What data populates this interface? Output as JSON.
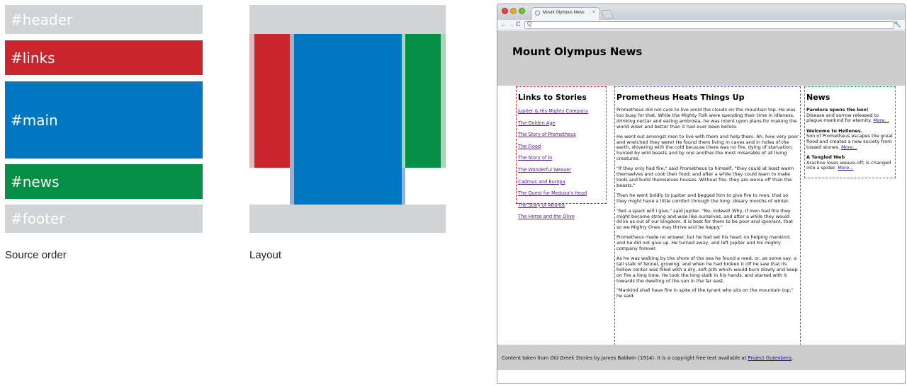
{
  "source_order": {
    "caption": "Source order",
    "blocks": [
      "#header",
      "#links",
      "#main",
      "#news",
      "#footer"
    ]
  },
  "layout": {
    "caption": "Layout"
  },
  "colors": {
    "header": "#d1d3d4",
    "links": "#c9252c",
    "main": "#0077c0",
    "news": "#058e45",
    "footer": "#d1d3d4"
  },
  "browser": {
    "tab_title": "Mount Olympus News",
    "tab_close": "×",
    "nav_back": "←",
    "nav_forward": "→",
    "nav_reload": "C",
    "url_icon": "Q",
    "wrench": "🔧",
    "page": {
      "title": "Mount Olympus News",
      "links_heading": "Links to Stories",
      "links": [
        "Jupiter & His Mighty Company",
        "The Golden Age",
        "The Story of Prometheus",
        "The Flood",
        "The Story of Io",
        "The Wonderful Weaver",
        "Cadmus and Europa",
        "The Quest for Medusa's Head",
        "The Story of Atlanta",
        "The Horse and the Olive"
      ],
      "main_heading": "Prometheus Heats Things Up",
      "paragraphs": [
        "Prometheus did not care to live amid the clouds on the mountain top. He was too busy for that. While the Mighty Folk were spending their time in idleness, drinking nectar and eating ambrosia, he was intent upon plans for making the world wiser and better than it had ever been before.",
        "He went out amongst men to live with them and help them. Ah, how very poor and wretched they were! He found them living in caves and in holes of the earth, shivering with the cold because there was no fire, dying of starvation, hunted by wild beasts and by one another-the most miserable of all living creatures.",
        "\"If they only had fire,\" said Prometheus to himself, \"they could at least warm themselves and cook their food; and after a while they could learn to make tools and build themselves houses. Without fire, they are worse off than the beasts.\"",
        "Then he went boldly to Jupiter and begged him to give fire to men, that so they might have a little comfort through the long, dreary months of winter.",
        "\"Not a spark will I give,\" said Jupiter. \"No, indeed! Why, if men had fire they might become strong and wise like ourselves, and after a while they would drive us out of our kingdom. It is best for them to be poor and ignorant, that so we Mighty Ones may thrive and be happy.\"",
        "Prometheus made no answer; but he had set his heart on helping mankind, and he did not give up. He turned away, and left Jupiter and his mighty company forever.",
        "As he was walking by the shore of the sea he found a reed, or, as some say, a tall stalk of fennel, growing; and when he had broken it off he saw that its hollow center was filled with a dry, soft pith which would burn slowly and keep on fire a long time. He took the long stalk in his hands, and started with it towards the dwelling of the sun in the far east.",
        "\"Mankind shall have fire in spite of the tyrant who sits on the mountain top,\" he said."
      ],
      "news_heading": "News",
      "news": [
        {
          "title": "Pandora opens the box!",
          "body": "Disease and sorrow released to plague mankind for eternity.",
          "more": "More..."
        },
        {
          "title": "Welcome to Hellenes.",
          "body": "Son of Prometheus escapes the great flood and creates a new society from tossed stones.",
          "more": "More..."
        },
        {
          "title": "A Tangled Web",
          "body": "Arachne loses weave-off; is changed into a spider.",
          "more": "More..."
        }
      ],
      "footer": {
        "prefix": "Content taken from ",
        "source": "Old Greek Stories",
        "middle": " by James Baldwin (1914). It is a copyright free text available at ",
        "link": "Project Gutenberg",
        "suffix": "."
      }
    }
  }
}
